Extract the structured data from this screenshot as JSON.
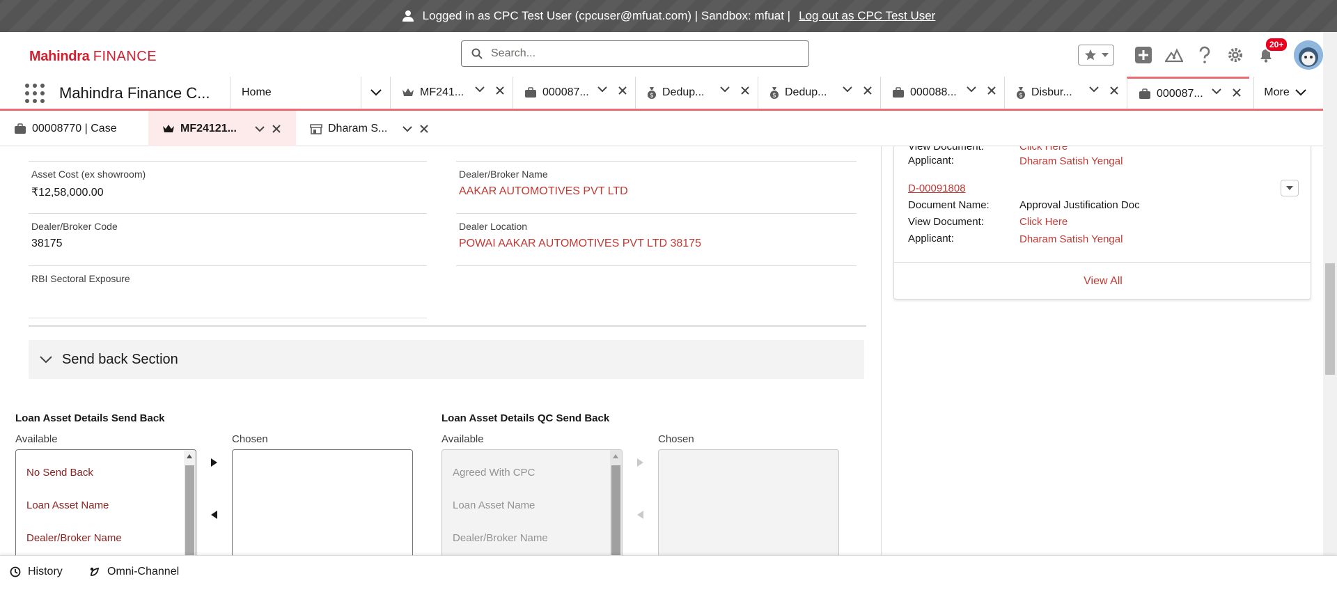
{
  "banner": {
    "logged_in_text": "Logged in as CPC Test User (cpcuser@mfuat.com) | Sandbox: mfuat |",
    "logout_link": "Log out as CPC Test User"
  },
  "header": {
    "logo_bold": "Mahindra",
    "logo_light": "FINANCE",
    "search_placeholder": "Search...",
    "notification_badge": "20+"
  },
  "appnav": {
    "app_name": "Mahindra Finance C...",
    "home": "Home",
    "tabs": [
      {
        "label": "MF241...",
        "icon": "crown-icon"
      },
      {
        "label": "000087...",
        "icon": "briefcase-icon"
      },
      {
        "label": "Dedup...",
        "icon": "money-bag-icon"
      },
      {
        "label": "Dedup...",
        "icon": "money-bag-icon"
      },
      {
        "label": "000088...",
        "icon": "briefcase-icon"
      },
      {
        "label": "Disbur...",
        "icon": "money-bag-icon"
      },
      {
        "label": "000087...",
        "icon": "briefcase-icon"
      }
    ],
    "more": "More"
  },
  "subtabs": [
    {
      "label": "00008770 | Case",
      "icon": "briefcase-icon"
    },
    {
      "label": "MF24121...",
      "icon": "crown-icon"
    },
    {
      "label": "Dharam S...",
      "icon": "store-icon"
    }
  ],
  "fields": {
    "asset_cost_label": "Asset Cost (ex showroom)",
    "asset_cost_value": "₹12,58,000.00",
    "dealer_name_label": "Dealer/Broker Name",
    "dealer_name_value": "AAKAR AUTOMOTIVES PVT LTD",
    "dealer_code_label": "Dealer/Broker Code",
    "dealer_code_value": "38175",
    "dealer_location_label": "Dealer Location",
    "dealer_location_value": "POWAI AAKAR AUTOMOTIVES PVT LTD 38175",
    "rbi_label": "RBI Sectoral Exposure",
    "rbi_value": ""
  },
  "send_back": {
    "section_title": "Send back Section",
    "left": {
      "title": "Loan Asset Details Send Back",
      "available_label": "Available",
      "chosen_label": "Chosen",
      "options": [
        "No Send Back",
        "Loan Asset Name",
        "Dealer/Broker Name"
      ]
    },
    "right": {
      "title": "Loan Asset Details QC Send Back",
      "available_label": "Available",
      "chosen_label": "Chosen",
      "options": [
        "Agreed With CPC",
        "Loan Asset Name",
        "Dealer/Broker Name"
      ]
    }
  },
  "docs_panel": {
    "partial_top_label": "View Document:",
    "partial_top_value": "Click Here",
    "applicant_label_1": "Applicant:",
    "applicant_value_1": "Dharam Satish Yengal",
    "doc_id": "D-00091808",
    "doc_name_label": "Document Name:",
    "doc_name_value": "Approval Justification Doc",
    "view_doc_label": "View Document:",
    "view_doc_value": "Click Here",
    "applicant_label_2": "Applicant:",
    "applicant_value_2": "Dharam Satish Yengal",
    "view_all": "View All"
  },
  "utility": {
    "history": "History",
    "omni": "Omni-Channel"
  },
  "colors": {
    "brand_red": "#d32030",
    "link_red": "#c23934",
    "tab_underline": "#ed6a70"
  }
}
